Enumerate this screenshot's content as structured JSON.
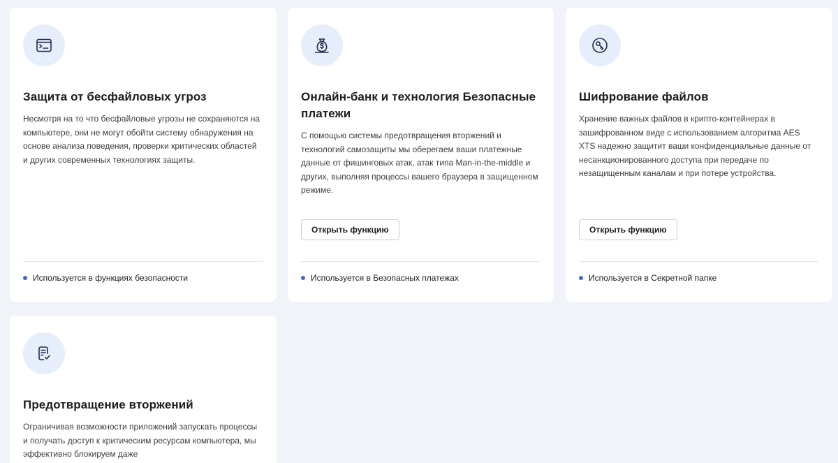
{
  "colors": {
    "page_bg": "#f0f3f7",
    "card_bg": "#ffffff",
    "icon_bg": "#e6eefc",
    "icon_stroke": "#1f2a4d",
    "accent_dot": "#3e68d8"
  },
  "cards": [
    {
      "icon": "terminal-window-icon",
      "title": "Защита от бесфайловых угроз",
      "description": "Несмотря на то что бесфайловые угрозы не сохраняются на компьютере, они не могут обойти систему обнаружения на основе анализа поведения, проверки критических областей и других современных технологиях защиты.",
      "usage": "Используется в функциях безопасности"
    },
    {
      "icon": "money-bag-icon",
      "title": "Онлайн-банк и технология Безопасные платежи",
      "description": "С помощью системы предотвращения вторжений и технологий самозащиты мы оберегаем ваши платежные данные от фишинговых атак, атак типа Man-in-the-middle и других, выполняя процессы вашего браузера в защищенном режиме.",
      "button": "Открыть функцию",
      "usage": "Используется в Безопасных платежах"
    },
    {
      "icon": "key-circle-icon",
      "title": "Шифрование файлов",
      "description": "Хранение важных файлов в крипто-контейнерах в зашифрованном виде с использованием алгоритма AES XTS надежно защитит ваши конфиденциальные данные от несанкционированного доступа при передаче по незащищенным каналам и при потере устройства.",
      "button": "Открыть функцию",
      "usage": "Используется в Секретной папке"
    },
    {
      "icon": "document-check-icon",
      "title": "Предотвращение вторжений",
      "description": "Ограничивая возможности приложений запускать процессы и получать доступ к критическим ресурсам компьютера, мы эффективно блокируем даже"
    }
  ]
}
